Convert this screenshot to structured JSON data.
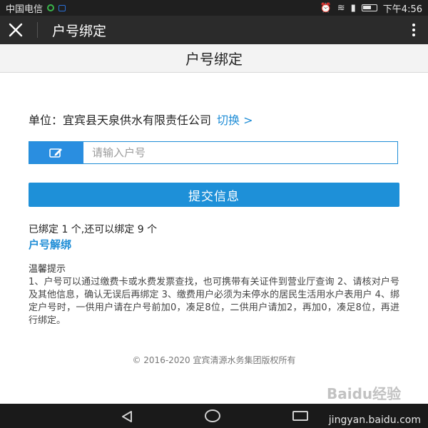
{
  "status_bar": {
    "carrier": "中国电信",
    "time": "下午4:56",
    "icons": [
      "wechat-dot-icon",
      "lock-icon",
      "alarm-icon",
      "wifi-icon",
      "signal-icon",
      "battery-icon"
    ]
  },
  "app_bar": {
    "title": "户号绑定",
    "close_icon": "close-icon",
    "more_icon": "more-vert-icon"
  },
  "page": {
    "header": "户号绑定",
    "unit_label": "单位：",
    "unit_name": "宜宾县天泉供水有限责任公司",
    "switch_label": "切换 >",
    "account_input": {
      "placeholder": "请输入户号",
      "value": "",
      "icon": "edit-icon"
    },
    "submit_label": "提交信息",
    "bound_status": "已绑定 1 个,还可以绑定 9 个",
    "unbind_link": "户号解绑",
    "tips_title": "温馨提示",
    "tips_body": "1、户号可以通过缴费卡或水费发票查找，也可携带有关证件到营业厅查询 2、请核对户号及其他信息，确认无误后再绑定 3、缴费用户必须为未停水的居民生活用水户表用户 4、绑定户号时，一供用户请在户号前加0，凑足8位，二供用户请加2，再加0，凑足8位，再进行绑定。",
    "footer": "© 2016-2020 宜宾清源水务集团版权所有"
  },
  "nav_bar": {
    "icons": [
      "back-triangle-icon",
      "home-circle-icon",
      "recents-square-icon"
    ],
    "watermark": "jingyan.baidu.com",
    "logo_text": "Baidu经验"
  },
  "colors": {
    "accent": "#1e90d8",
    "link": "#1f8dd6",
    "appbar": "#2b2b2b",
    "statusbar": "#1f1f1f"
  }
}
